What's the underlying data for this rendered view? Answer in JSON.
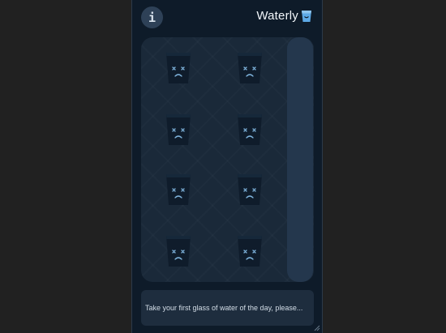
{
  "header": {
    "info_label": "i",
    "brand_name": "Waterly"
  },
  "glasses": [
    {
      "state": "empty",
      "mood": "sad"
    },
    {
      "state": "empty",
      "mood": "sad"
    },
    {
      "state": "empty",
      "mood": "sad"
    },
    {
      "state": "empty",
      "mood": "sad"
    },
    {
      "state": "empty",
      "mood": "sad"
    },
    {
      "state": "empty",
      "mood": "sad"
    },
    {
      "state": "empty",
      "mood": "sad"
    },
    {
      "state": "empty",
      "mood": "sad"
    }
  ],
  "progress": {
    "fraction": 0
  },
  "message": "Take your first glass of water of the day, please...",
  "colors": {
    "background": "#212121",
    "app_bg": "#0e1b29",
    "panel_bg": "#1a2939",
    "glass_body": "#0f1c2b",
    "glass_face": "#7fb4dd",
    "brand_accent": "#5da9e6",
    "progress_track": "#24374d"
  },
  "icons": {
    "info": "info-icon",
    "brand": "glass-logo-icon",
    "glass": "sad-glass-icon"
  }
}
